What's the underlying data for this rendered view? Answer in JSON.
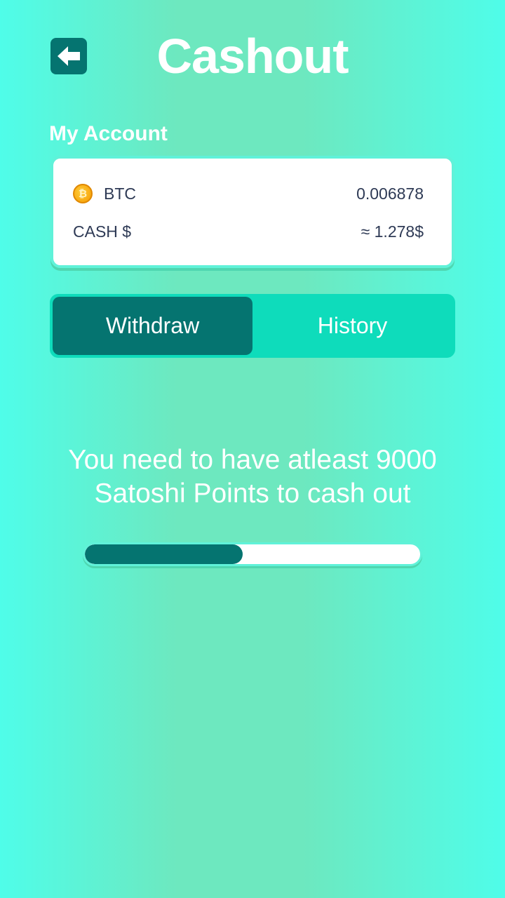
{
  "header": {
    "title": "Cashout",
    "back_icon": "arrow-left-icon"
  },
  "account": {
    "section_label": "My Account",
    "btc_icon": "bitcoin-icon",
    "btc_symbol": "₿",
    "btc_label": "BTC",
    "btc_value": "0.006878",
    "cash_label": "CASH $",
    "cash_value": "≈ 1.278$"
  },
  "tabs": [
    {
      "label": "Withdraw",
      "active": true
    },
    {
      "label": "History",
      "active": false
    }
  ],
  "message": {
    "line1": "You need to have atleast 9000",
    "line2": "Satoshi Points to cash out"
  },
  "progress": {
    "fraction": 0.47
  },
  "colors": {
    "accent_dark": "#057470",
    "tab_bg": "#0edcbb",
    "text_dark": "#2e3a55"
  }
}
